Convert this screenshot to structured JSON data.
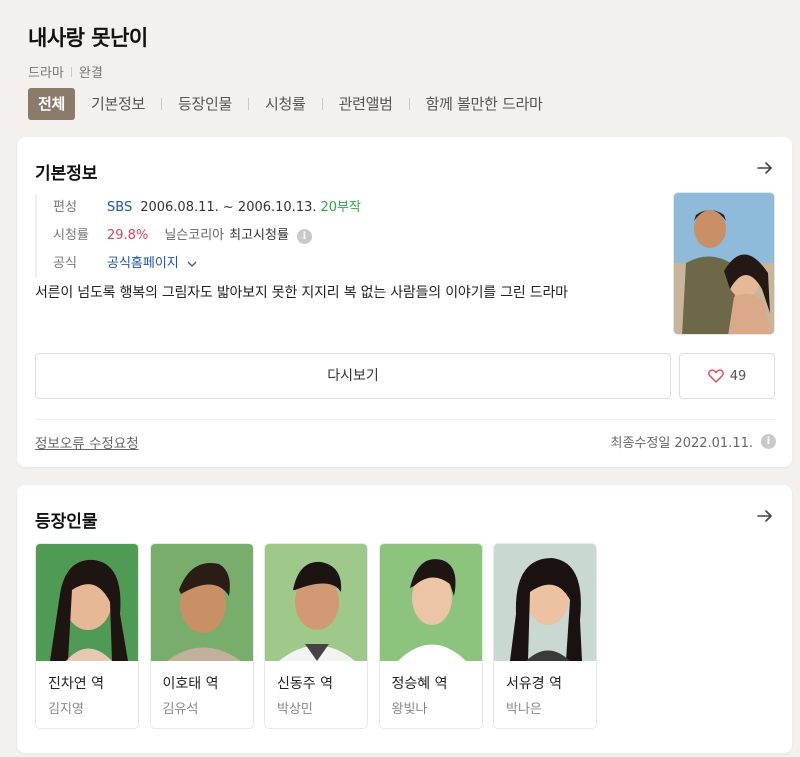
{
  "header": {
    "title": "내사랑 못난이",
    "genre": "드라마",
    "status": "완결",
    "tabs": [
      "전체",
      "기본정보",
      "등장인물",
      "시청률",
      "관련앨범",
      "함께 볼만한 드라마"
    ]
  },
  "basic_info": {
    "section_title": "기본정보",
    "broadcast_label": "편성",
    "broadcaster": "SBS",
    "period": "2006.08.11. ~ 2006.10.13.",
    "episodes": "20부작",
    "rating_label": "시청률",
    "rating_value": "29.8%",
    "rating_source": "닐슨코리아",
    "rating_type": "최고시청률",
    "official_label": "공식",
    "official_link": "공식홈페이지",
    "description": "서른이 넘도록 행복의 그림자도 밟아보지 못한 지지리 복 없는 사람들의 이야기를 그린 드라마",
    "replay_button": "다시보기",
    "like_count": "49",
    "report_link": "정보오류 수정요청",
    "last_updated": "최종수정일 2022.01.11."
  },
  "cast": {
    "section_title": "등장인물",
    "members": [
      {
        "role": "진차연 역",
        "actor": "김지영"
      },
      {
        "role": "이호태 역",
        "actor": "김유석"
      },
      {
        "role": "신동주 역",
        "actor": "박상민"
      },
      {
        "role": "정승혜 역",
        "actor": "왕빛나"
      },
      {
        "role": "서유경 역",
        "actor": "박나은"
      }
    ]
  },
  "colors": {
    "active_tab": "#8a7a6a",
    "link_blue": "#1f52b0",
    "episodes_green": "#2ea84a",
    "rating_red": "#e0425b",
    "background": "#f3f0ed"
  },
  "icons": [
    "arrow-right-icon",
    "info-icon",
    "chevron-down-icon",
    "heart-icon"
  ]
}
